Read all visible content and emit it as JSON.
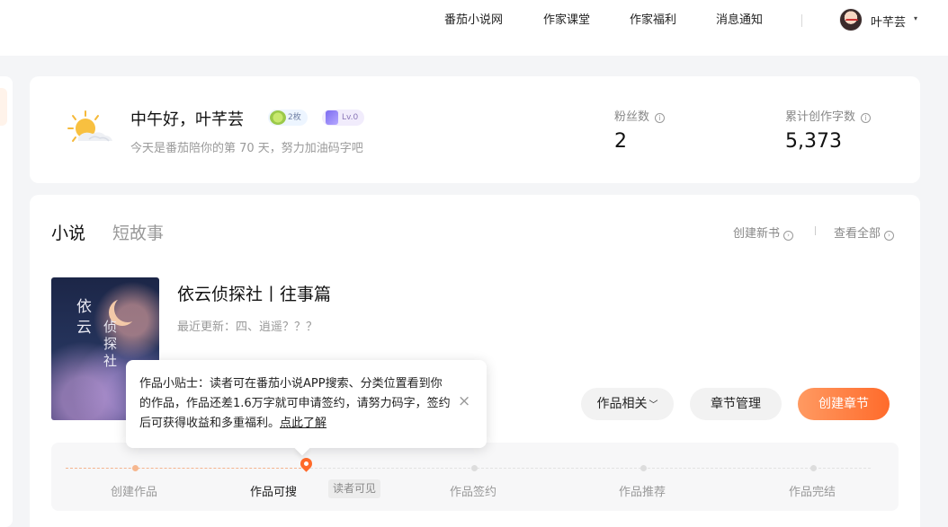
{
  "nav": {
    "items": [
      "番茄小说网",
      "作家课堂",
      "作家福利",
      "消息通知"
    ],
    "user_name": "叶芊芸",
    "caret": "▾"
  },
  "greeting": {
    "title": "中午好，叶芊芸",
    "coin_badge": "2枚",
    "level_badge": "Lv.0",
    "subtitle": "今天是番茄陪你的第 70 天，努力加油码字吧"
  },
  "stats": [
    {
      "label": "粉丝数",
      "value": "2"
    },
    {
      "label": "累计创作字数",
      "value": "5,373"
    }
  ],
  "works": {
    "tabs": [
      "小说",
      "短故事"
    ],
    "create_book": "创建新书",
    "view_all": "查看全部",
    "book": {
      "title": "依云侦探社丨往事篇",
      "latest_update": "最近更新：四、逍遥？？？",
      "cover_text_1": "依云",
      "cover_text_2": "侦探社"
    },
    "buttons": {
      "related": "作品相关",
      "chapters": "章节管理",
      "create_chapter": "创建章节"
    },
    "progress": {
      "steps": [
        "创建作品",
        "作品可搜",
        "作品签约",
        "作品推荐",
        "作品完结"
      ],
      "current_step": 2,
      "current_tag": "读者可见"
    }
  },
  "tooltip": {
    "text": "作品小贴士：读者可在番茄小说APP搜索、分类位置看到你的作品，作品还差1.6万字就可申请签约，请努力码字，签约后可获得收益和多重福利。",
    "link": "点此了解",
    "close": "×"
  },
  "colors": {
    "accent": "#ff6a2a",
    "accent_gradient_start": "#ff9a62"
  }
}
